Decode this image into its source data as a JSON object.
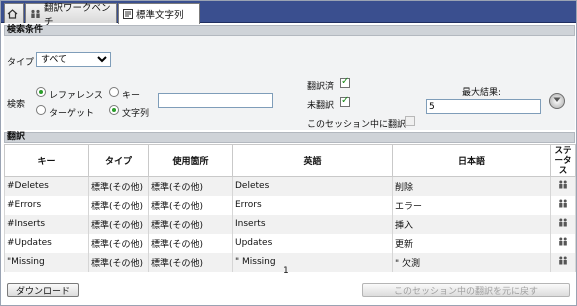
{
  "tabs": [
    {
      "label": ""
    },
    {
      "label": "翻訳ワークベンチ"
    },
    {
      "label": "標準文字列"
    }
  ],
  "search": {
    "header": "検索条件",
    "type_label": "タイプ",
    "type_value": "すべて",
    "search_label": "検索",
    "radio_reference": "レファレンス",
    "radio_key": "キー",
    "radio_target": "ターゲット",
    "radio_string": "文字列",
    "search_text": "",
    "translated_label": "翻訳済",
    "untranslated_label": "未翻訳",
    "session_label": "このセッション中に翻訳",
    "max_results_label": "最大結果:",
    "max_results_value": "5"
  },
  "results": {
    "header": "翻訳",
    "columns": [
      "キー",
      "タイプ",
      "使用箇所",
      "英語",
      "日本語",
      "ステータス"
    ],
    "rows": [
      {
        "key": "#Deletes",
        "type": "標準(その他)",
        "usage": "標準(その他)",
        "english": "Deletes",
        "japanese": "削除"
      },
      {
        "key": "#Errors",
        "type": "標準(その他)",
        "usage": "標準(その他)",
        "english": "Errors",
        "japanese": "エラー"
      },
      {
        "key": "#Inserts",
        "type": "標準(その他)",
        "usage": "標準(その他)",
        "english": "Inserts",
        "japanese": "挿入"
      },
      {
        "key": "#Updates",
        "type": "標準(その他)",
        "usage": "標準(その他)",
        "english": "Updates",
        "japanese": "更新"
      },
      {
        "key": "\"Missing",
        "type": "標準(その他)",
        "usage": "標準(その他)",
        "english": "\" Missing",
        "japanese": "\" 欠測"
      }
    ],
    "page": "1"
  },
  "buttons": {
    "download": "ダウンロード",
    "revert": "このセッション中の翻訳を元に戻す"
  },
  "icons": {
    "home": "home-icon",
    "workbench": "people-icon",
    "strings": "document-icon",
    "status": "status-people-icon"
  },
  "colors": {
    "tabbar": "#3a4f8f",
    "section_header": "#cfd3d8",
    "check": "#1b8b1b"
  }
}
